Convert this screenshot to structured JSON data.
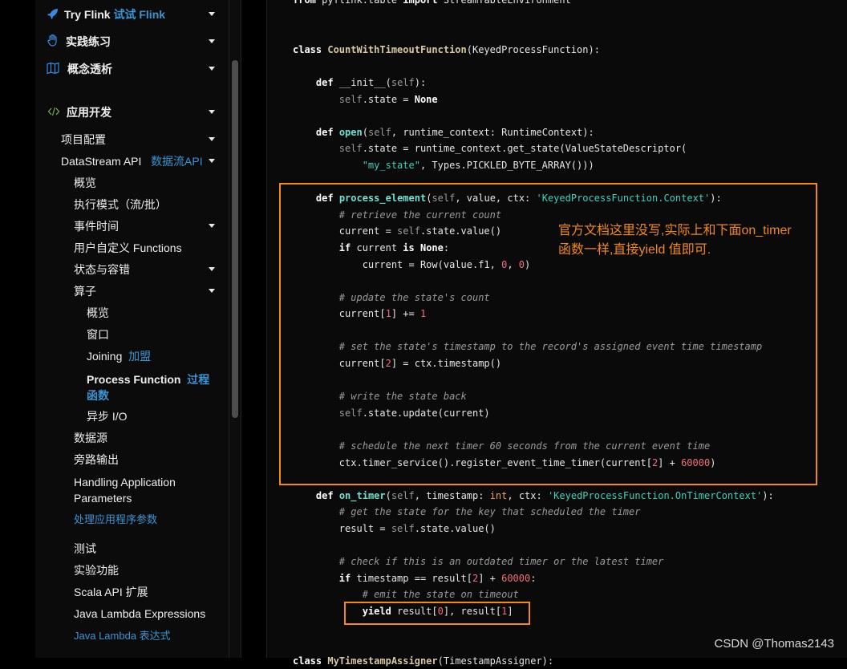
{
  "sidebar": {
    "top_items": [
      {
        "icon": "rocket-icon",
        "label": "Try Flink",
        "label_zh": "试试 Flink"
      },
      {
        "icon": "hand-icon",
        "label": "实践练习"
      },
      {
        "icon": "map-icon",
        "label": "概念透析"
      },
      {
        "icon": "code-icon",
        "label": "应用开发"
      }
    ],
    "items": {
      "project_config": "项目配置",
      "datastream": {
        "label": "DataStream API",
        "label_zh": "数据流API"
      },
      "overview": "概览",
      "exec_mode": "执行模式（流/批）",
      "event_time": "事件时间",
      "udf": "用户自定义 Functions",
      "state": "状态与容错",
      "operators": "算子",
      "op_overview": "概览",
      "op_window": "窗口",
      "op_joining": {
        "label": "Joining",
        "label_zh": "加盟"
      },
      "op_process": {
        "label": "Process Function",
        "label_zh_1": "过程",
        "label_zh_2": "函数"
      },
      "op_async": "异步 I/O",
      "sources": "数据源",
      "side_output": "旁路输出",
      "handling_params_1": "Handling Application",
      "handling_params_2": "Parameters",
      "handling_params_zh": "处理应用程序参数",
      "testing": "测试",
      "experimental": "实验功能",
      "scala_ext": "Scala API 扩展",
      "java_lambda": "Java Lambda Expressions",
      "java_lambda_zh": "Java Lambda 表达式"
    }
  },
  "annotation": {
    "line1": "官方文档这里没写,实际上和下面on_timer",
    "line2": "函数一样,直接yield 值即可."
  },
  "colors": {
    "highlight": "#f28b10",
    "link_blue": "#3a94d4"
  },
  "watermark": "CSDN @Thomas2143"
}
